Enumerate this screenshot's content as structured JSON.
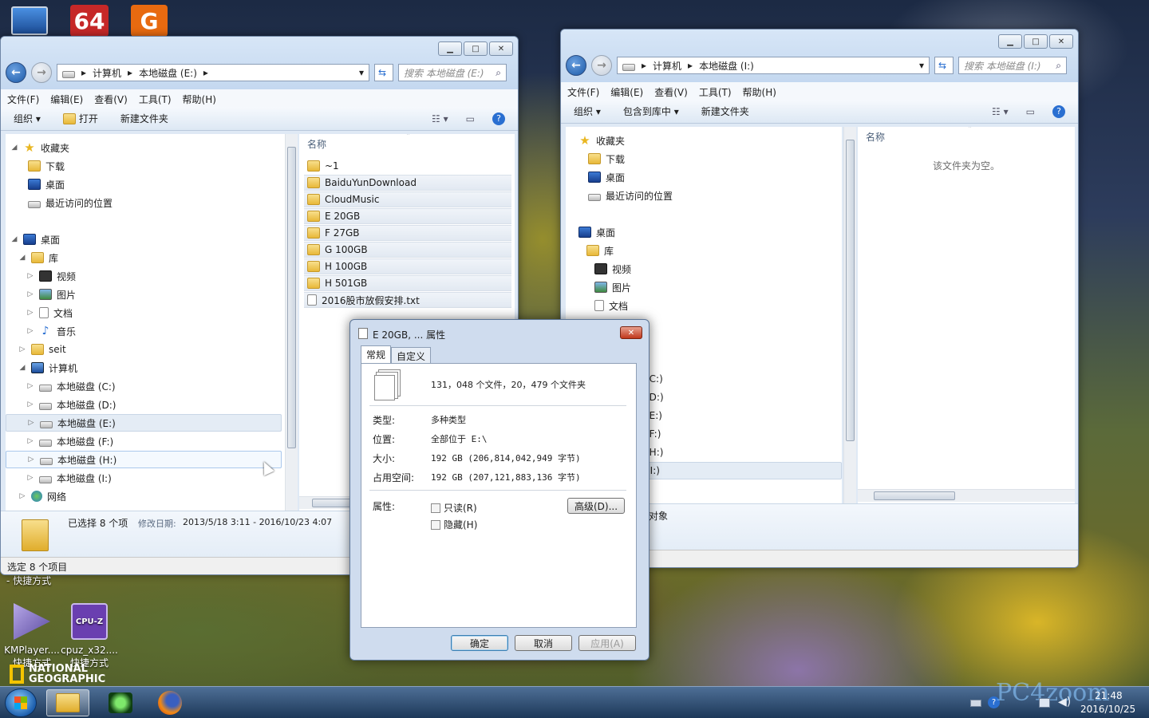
{
  "desktop": {
    "top_icons": [
      {
        "label": "64",
        "color": "#c62828"
      },
      {
        "label": "G",
        "color": "#e86a10"
      }
    ],
    "shortcut_suffix": "- 快捷方式",
    "icons": [
      {
        "label": "KMPlayer....",
        "sub": "快捷方式"
      },
      {
        "label": "cpuz_x32....",
        "sub": "快捷方式"
      }
    ],
    "brand": "NATIONAL GEOGRAPHIC",
    "cpuz_text": "CPU-Z"
  },
  "left_window": {
    "address": [
      "计算机",
      "本地磁盘 (E:)"
    ],
    "search_placeholder": "搜索 本地磁盘 (E:)",
    "menu": [
      "文件(F)",
      "编辑(E)",
      "查看(V)",
      "工具(T)",
      "帮助(H)"
    ],
    "toolbar": {
      "organize": "组织",
      "open": "打开",
      "new_folder": "新建文件夹"
    },
    "nav": {
      "favorites": "收藏夹",
      "downloads": "下载",
      "desktop": "桌面",
      "recent": "最近访问的位置",
      "desktop_root": "桌面",
      "libraries": "库",
      "videos": "视频",
      "pictures": "图片",
      "documents": "文档",
      "music": "音乐",
      "user": "seit",
      "computer": "计算机",
      "drives": [
        "本地磁盘 (C:)",
        "本地磁盘 (D:)",
        "本地磁盘 (E:)",
        "本地磁盘 (F:)",
        "本地磁盘 (H:)",
        "本地磁盘 (I:)"
      ],
      "network": "网络"
    },
    "column_name": "名称",
    "files": [
      {
        "name": "~1",
        "type": "folder",
        "selected": false
      },
      {
        "name": "BaiduYunDownload",
        "type": "folder",
        "selected": true
      },
      {
        "name": "CloudMusic",
        "type": "folder",
        "selected": true
      },
      {
        "name": "E 20GB",
        "type": "folder",
        "selected": true
      },
      {
        "name": "F 27GB",
        "type": "folder",
        "selected": true
      },
      {
        "name": "G 100GB",
        "type": "folder",
        "selected": true
      },
      {
        "name": "H 100GB",
        "type": "folder",
        "selected": true
      },
      {
        "name": "H 501GB",
        "type": "folder",
        "selected": true
      },
      {
        "name": "2016股市放假安排.txt",
        "type": "txt",
        "selected": true
      }
    ],
    "details": {
      "selected": "已选择 8 个项",
      "modified_label": "修改日期:",
      "modified": "2013/5/18 3:11 - 2016/10/23 4:07"
    },
    "status": "选定 8 个项目"
  },
  "right_window": {
    "address": [
      "计算机",
      "本地磁盘 (I:)"
    ],
    "search_placeholder": "搜索 本地磁盘 (I:)",
    "menu": [
      "文件(F)",
      "编辑(E)",
      "查看(V)",
      "工具(T)",
      "帮助(H)"
    ],
    "toolbar": {
      "organize": "组织",
      "include": "包含到库中",
      "new_folder": "新建文件夹"
    },
    "nav": {
      "favorites": "收藏夹",
      "downloads": "下载",
      "desktop": "桌面",
      "recent": "最近访问的位置",
      "desktop_root": "桌面",
      "libraries": "库",
      "videos": "视频",
      "pictures": "图片",
      "documents": "文档",
      "drives_partial": [
        "(C:)",
        "(D:)",
        "(E:)",
        "(F:)",
        "(H:)",
        "(I:)"
      ]
    },
    "column_name": "名称",
    "empty": "该文件夹为空。",
    "details": "对象"
  },
  "dialog": {
    "title": "E 20GB, ... 属性",
    "tabs": [
      "常规",
      "自定义"
    ],
    "summary": "131，048 个文件，20，479 个文件夹",
    "props": [
      {
        "label": "类型:",
        "value": "多种类型"
      },
      {
        "label": "位置:",
        "value": "全部位于 E:\\"
      },
      {
        "label": "大小:",
        "value": "192 GB (206,814,042,949 字节)"
      },
      {
        "label": "占用空间:",
        "value": "192 GB (207,121,883,136 字节)"
      }
    ],
    "attr_label": "属性:",
    "readonly": "只读(R)",
    "hidden": "隐藏(H)",
    "advanced": "高级(D)...",
    "ok": "确定",
    "cancel": "取消",
    "apply": "应用(A)"
  },
  "taskbar": {
    "date": "2016/10/25",
    "watermark": "PC4zoom",
    "time": "21:48"
  }
}
